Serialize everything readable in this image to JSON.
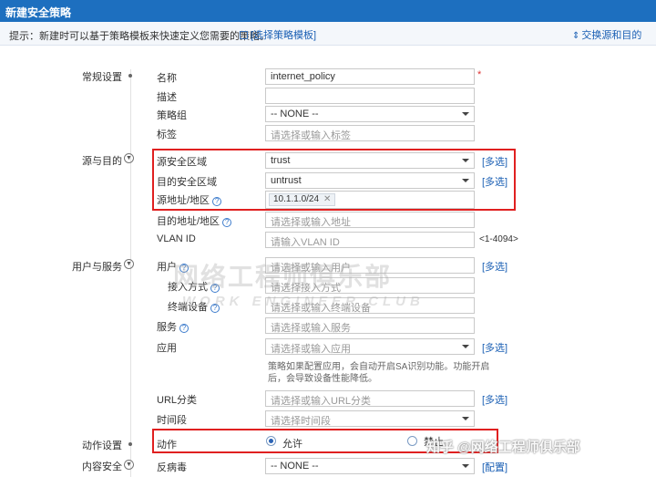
{
  "dialog": {
    "title": "新建安全策略"
  },
  "tip": {
    "text": "提示：新建时可以基于策略模板来快速定义您需要的策略。",
    "template_link": "[选择策略模板]",
    "swap_link": "交换源和目的"
  },
  "sections": {
    "general": "常规设置",
    "source_dest": "源与目的",
    "user_service": "用户与服务",
    "action_settings": "动作设置",
    "content_security": "内容安全"
  },
  "fields": {
    "name": {
      "label": "名称",
      "value": "internet_policy",
      "required_mark": "*"
    },
    "description": {
      "label": "描述",
      "value": ""
    },
    "policy_group": {
      "label": "策略组",
      "value": "-- NONE --"
    },
    "tag": {
      "label": "标签",
      "placeholder": "请选择或输入标签"
    },
    "src_zone": {
      "label": "源安全区域",
      "value": "trust",
      "multi": "[多选]"
    },
    "dst_zone": {
      "label": "目的安全区域",
      "value": "untrust",
      "multi": "[多选]"
    },
    "src_addr": {
      "label": "源地址/地区",
      "tag": "10.1.1.0/24"
    },
    "dst_addr": {
      "label": "目的地址/地区",
      "placeholder": "请选择或输入地址"
    },
    "vlan": {
      "label": "VLAN ID",
      "placeholder": "请输入VLAN ID",
      "range": "<1-4094>"
    },
    "user": {
      "label": "用户",
      "placeholder": "请选择或输入用户",
      "multi": "[多选]"
    },
    "access_mode": {
      "label": "接入方式",
      "placeholder": "请选择接入方式"
    },
    "terminal": {
      "label": "终端设备",
      "placeholder": "请选择或输入终端设备"
    },
    "service": {
      "label": "服务",
      "placeholder": "请选择或输入服务"
    },
    "application": {
      "label": "应用",
      "placeholder": "请选择或输入应用",
      "multi": "[多选]",
      "note_line1": "策略如果配置应用，会自动开启SA识别功能。功能开启",
      "note_line2": "后，会导致设备性能降低。"
    },
    "url_category": {
      "label": "URL分类",
      "placeholder": "请选择或输入URL分类",
      "multi": "[多选]"
    },
    "time_range": {
      "label": "时间段",
      "placeholder": "请选择时间段"
    },
    "action": {
      "label": "动作",
      "permit": "允许",
      "deny": "禁止",
      "selected": "permit"
    },
    "antivirus": {
      "label": "反病毒",
      "value": "-- NONE --",
      "config": "[配置]"
    }
  },
  "watermarks": {
    "center_line1": "网络工程师俱乐部",
    "center_line2": "WORK ENGINEER CLUB",
    "corner": "知乎 @网络工程师俱乐部"
  }
}
